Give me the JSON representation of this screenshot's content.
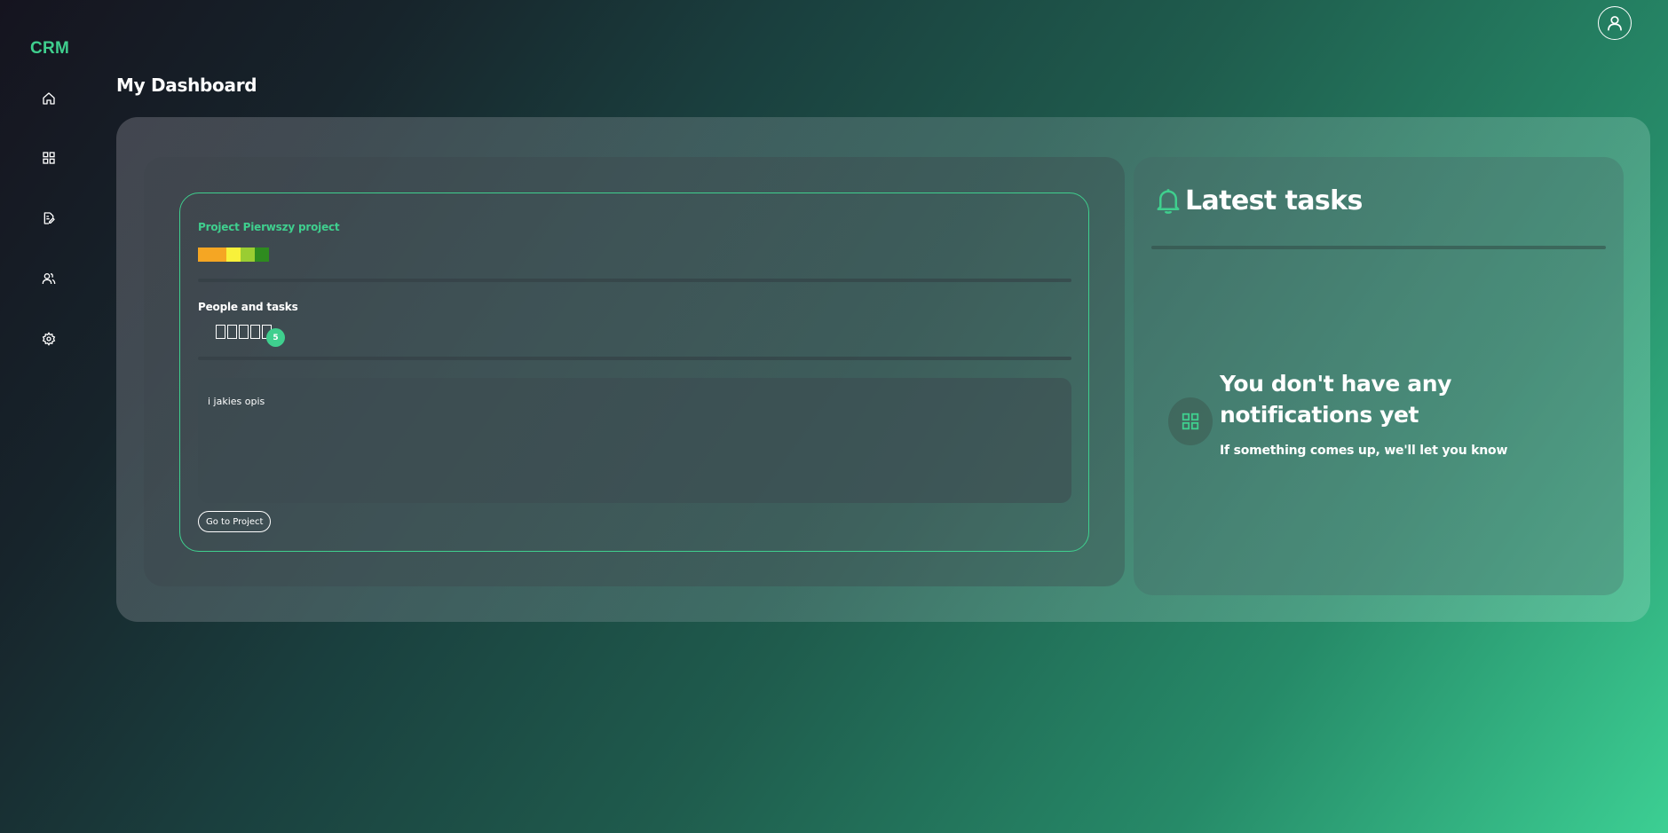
{
  "app": {
    "logo": "CRM"
  },
  "sidebar": {
    "items": [
      {
        "name": "home",
        "icon": "home-icon"
      },
      {
        "name": "projects",
        "icon": "grid-icon"
      },
      {
        "name": "documents",
        "icon": "document-edit-icon"
      },
      {
        "name": "users",
        "icon": "users-icon"
      },
      {
        "name": "settings",
        "icon": "gear-icon"
      }
    ]
  },
  "header": {
    "profile_icon": "user-icon"
  },
  "page": {
    "title": "My Dashboard"
  },
  "project_card": {
    "title": "Project Pierwszy project",
    "status_colors": [
      "#f5a623",
      "#f5a623",
      "#f8f13a",
      "#9acd32",
      "#2e8b1f"
    ],
    "people_label": "People and tasks",
    "avatar_count": 5,
    "badge_count": "5",
    "description": "i jakies opis",
    "button_label": "Go to Project"
  },
  "tasks_panel": {
    "icon": "bell-icon",
    "title": "Latest tasks",
    "empty_icon": "grid-icon",
    "empty_title": "You don't have any notifications yet",
    "empty_subtitle": "If something comes up, we'll let you know"
  },
  "colors": {
    "accent": "#3fcf8e",
    "text": "#ffffff"
  }
}
